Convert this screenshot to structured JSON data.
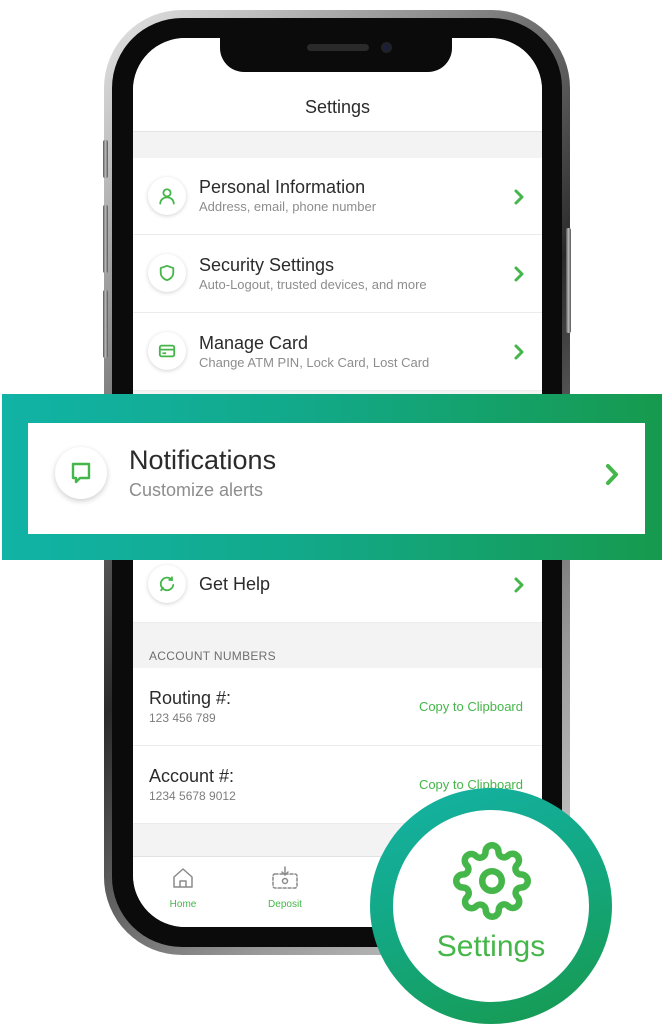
{
  "colors": {
    "accent": "#45b649",
    "banner_gradient": [
      "#11b3a6",
      "#169a4e"
    ]
  },
  "header": {
    "title": "Settings"
  },
  "menu": {
    "items": [
      {
        "icon": "person-icon",
        "title": "Personal Information",
        "subtitle": "Address, email, phone number"
      },
      {
        "icon": "shield-icon",
        "title": "Security Settings",
        "subtitle": "Auto-Logout, trusted devices, and more"
      },
      {
        "icon": "credit-card-icon",
        "title": "Manage Card",
        "subtitle": "Change ATM PIN, Lock Card, Lost Card"
      },
      {
        "icon": "help-chat-icon",
        "title": "Get Help"
      }
    ]
  },
  "highlight": {
    "icon": "chat-bubble-icon",
    "title": "Notifications",
    "subtitle": "Customize alerts"
  },
  "account_numbers": {
    "header": "ACCOUNT NUMBERS",
    "rows": [
      {
        "label": "Routing #:",
        "value": "123 456 789",
        "action": "Copy to Clipboard"
      },
      {
        "label": "Account #:",
        "value": "1234 5678 9012",
        "action": "Copy to Clipboard"
      }
    ]
  },
  "tab_bar": {
    "tabs": [
      {
        "icon": "home-icon",
        "label": "Home"
      },
      {
        "icon": "deposit-icon",
        "label": "Deposit"
      }
    ]
  },
  "badge": {
    "icon": "gear-icon",
    "label": "Settings"
  }
}
